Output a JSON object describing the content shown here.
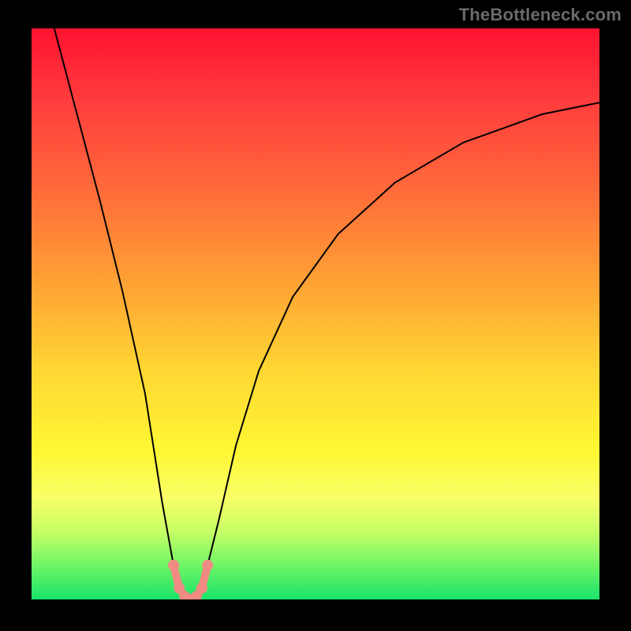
{
  "watermark": "TheBottleneck.com",
  "chart_data": {
    "type": "line",
    "title": "",
    "xlabel": "",
    "ylabel": "",
    "xlim": [
      0,
      100
    ],
    "ylim": [
      0,
      100
    ],
    "grid": false,
    "series": [
      {
        "name": "bottleneck-curve",
        "color": "#000000",
        "x": [
          4,
          8,
          12,
          16,
          20,
          23,
          25,
          26,
          27,
          28,
          29,
          30,
          31,
          33,
          36,
          40,
          46,
          54,
          64,
          76,
          90,
          100
        ],
        "y": [
          100,
          85,
          70,
          54,
          36,
          17,
          6,
          2,
          0.5,
          0,
          0.5,
          2,
          6,
          14,
          27,
          40,
          53,
          64,
          73,
          80,
          85,
          87
        ]
      },
      {
        "name": "min-highlight",
        "color": "#ef8b82",
        "x": [
          25,
          26,
          27,
          28,
          29,
          30,
          31
        ],
        "y": [
          6,
          2,
          0.5,
          0,
          0.5,
          2,
          6
        ]
      }
    ],
    "minimum_at_x": 28,
    "notes": "Axes unlabeled in source image; values are estimated proportions (0-100) read from curve position relative to plot area."
  }
}
